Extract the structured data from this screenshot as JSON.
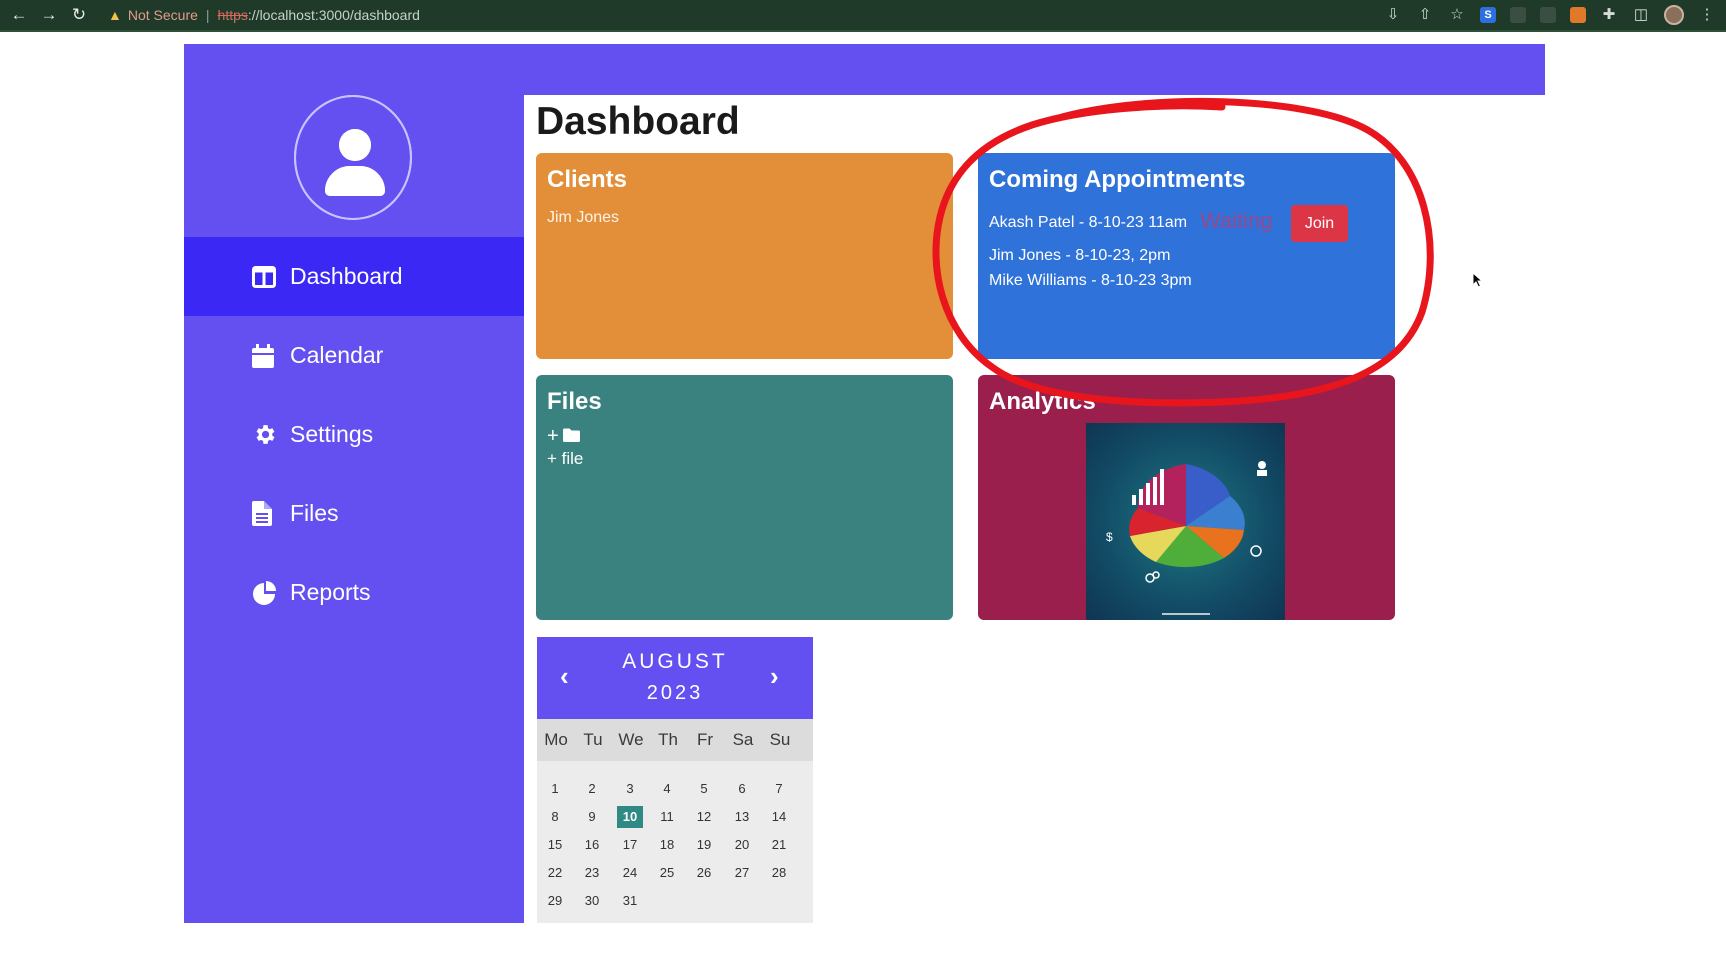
{
  "browser": {
    "security_text": "Not Secure",
    "separator": "|",
    "url_scheme": "https",
    "url_rest": "://localhost:3000/dashboard"
  },
  "sidebar": {
    "items": [
      {
        "label": "Dashboard",
        "icon": "columns-icon",
        "active": true
      },
      {
        "label": "Calendar",
        "icon": "calendar-icon",
        "active": false
      },
      {
        "label": "Settings",
        "icon": "gear-icon",
        "active": false
      },
      {
        "label": "Files",
        "icon": "file-icon",
        "active": false
      },
      {
        "label": "Reports",
        "icon": "pie-chart-icon",
        "active": false
      }
    ]
  },
  "main": {
    "title": "Dashboard",
    "clients": {
      "title": "Clients",
      "items": [
        "Jim Jones"
      ]
    },
    "appointments": {
      "title": "Coming Appointments",
      "items": [
        "Akash Patel - 8-10-23 11am",
        "Jim Jones - 8-10-23, 2pm",
        "Mike Williams - 8-10-23 3pm"
      ],
      "status": "Waiting",
      "join_label": "Join"
    },
    "files": {
      "title": "Files",
      "add_folder": "+",
      "add_file": "+ file"
    },
    "analytics": {
      "title": "Analytics"
    }
  },
  "calendar": {
    "month": "AUGUST",
    "year": "2023",
    "prev": "‹",
    "next": "›",
    "weekdays": [
      "Mo",
      "Tu",
      "We",
      "Th",
      "Fr",
      "Sa",
      "Su"
    ],
    "days": [
      "1",
      "2",
      "3",
      "4",
      "5",
      "6",
      "7",
      "8",
      "9",
      "10",
      "11",
      "12",
      "13",
      "14",
      "15",
      "16",
      "17",
      "18",
      "19",
      "20",
      "21",
      "22",
      "23",
      "24",
      "25",
      "26",
      "27",
      "28",
      "29",
      "30",
      "31"
    ],
    "selected_day": "10"
  },
  "colors": {
    "brand": "#6450f0",
    "active_nav": "#3b28f5",
    "clients": "#e38e39",
    "appointments": "#2f72d9",
    "files": "#3a8280",
    "analytics": "#9a1f4c",
    "join": "#dc3545",
    "annotation": "#e8161c"
  }
}
